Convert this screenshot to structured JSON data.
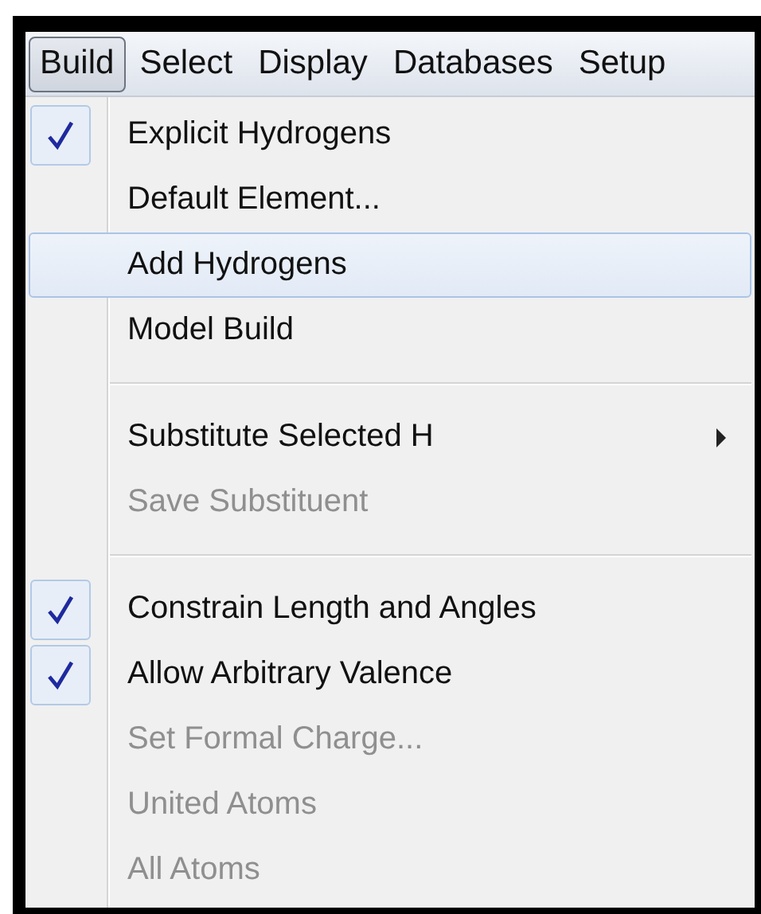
{
  "menu_bar": [
    {
      "label": "Build",
      "selected": true
    },
    {
      "label": "Select",
      "selected": false
    },
    {
      "label": "Display",
      "selected": false
    },
    {
      "label": "Databases",
      "selected": false
    },
    {
      "label": "Setup",
      "selected": false
    }
  ],
  "menu": {
    "items": [
      {
        "kind": "item",
        "label": "Explicit Hydrogens",
        "checked": true,
        "disabled": false,
        "selected": false,
        "submenu": false
      },
      {
        "kind": "item",
        "label": "Default Element...",
        "checked": false,
        "disabled": false,
        "selected": false,
        "submenu": false
      },
      {
        "kind": "item",
        "label": "Add Hydrogens",
        "checked": false,
        "disabled": false,
        "selected": true,
        "submenu": false
      },
      {
        "kind": "item",
        "label": "Model Build",
        "checked": false,
        "disabled": false,
        "selected": false,
        "submenu": false
      },
      {
        "kind": "separator"
      },
      {
        "kind": "item",
        "label": "Substitute Selected H",
        "checked": false,
        "disabled": false,
        "selected": false,
        "submenu": true
      },
      {
        "kind": "item",
        "label": "Save Substituent",
        "checked": false,
        "disabled": true,
        "selected": false,
        "submenu": false
      },
      {
        "kind": "separator"
      },
      {
        "kind": "item",
        "label": "Constrain Length and Angles",
        "checked": true,
        "disabled": false,
        "selected": false,
        "submenu": false
      },
      {
        "kind": "item",
        "label": "Allow Arbitrary Valence",
        "checked": true,
        "disabled": false,
        "selected": false,
        "submenu": false
      },
      {
        "kind": "item",
        "label": "Set Formal Charge...",
        "checked": false,
        "disabled": true,
        "selected": false,
        "submenu": false
      },
      {
        "kind": "item",
        "label": "United Atoms",
        "checked": false,
        "disabled": true,
        "selected": false,
        "submenu": false
      },
      {
        "kind": "item",
        "label": "All Atoms",
        "checked": false,
        "disabled": true,
        "selected": false,
        "submenu": false
      }
    ]
  }
}
